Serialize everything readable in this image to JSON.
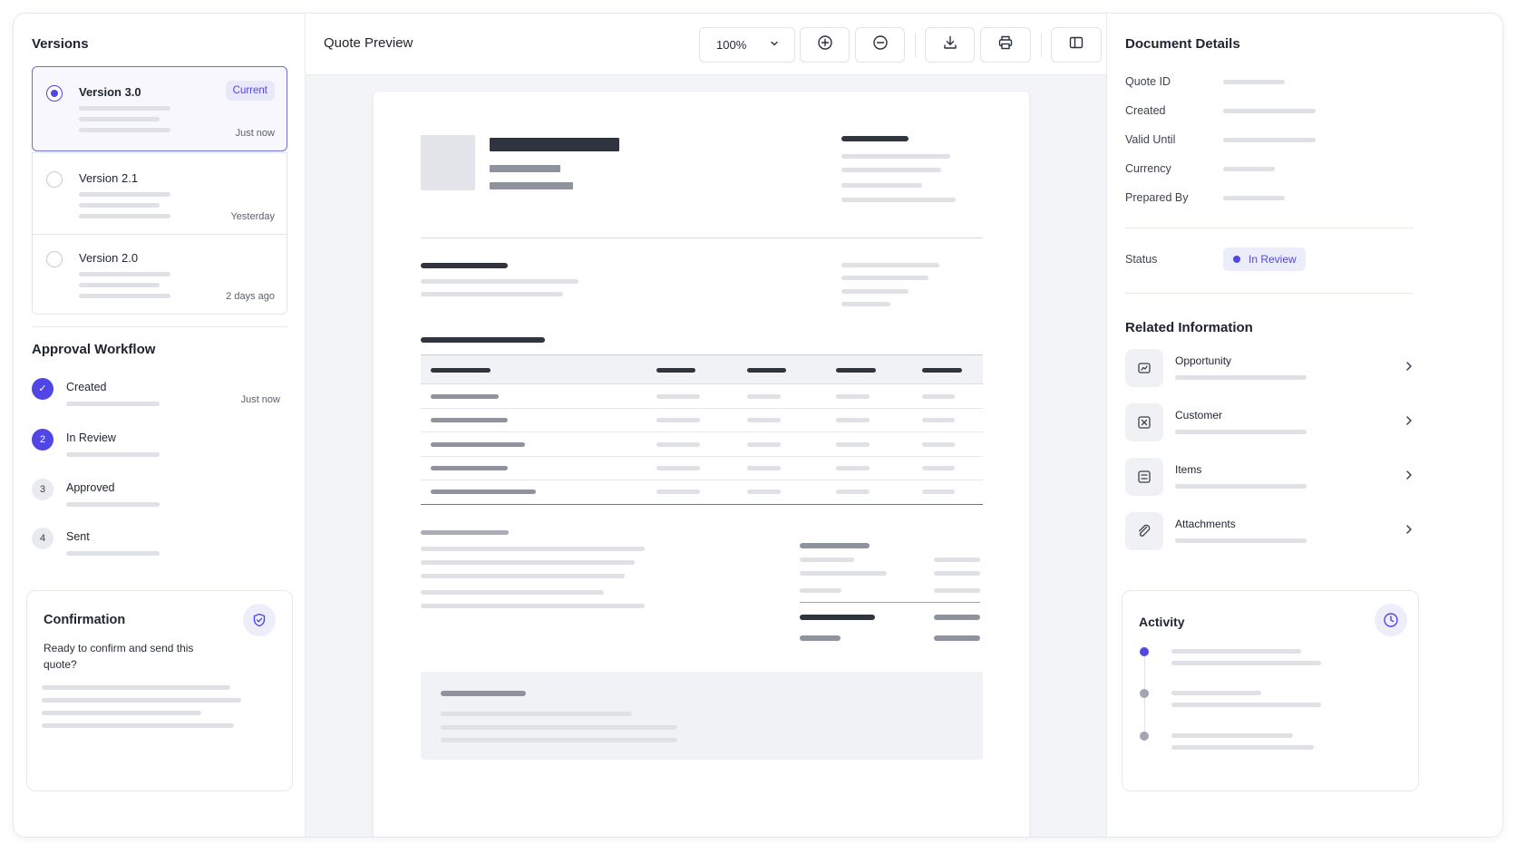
{
  "versions": {
    "title": "Versions",
    "items": [
      {
        "name": "Version 3.0",
        "badge": "Current",
        "time": "Just now",
        "selected": true
      },
      {
        "name": "Version 2.1",
        "badge": "",
        "time": "Yesterday",
        "selected": false
      },
      {
        "name": "Version 2.0",
        "badge": "",
        "time": "2 days ago",
        "selected": false
      }
    ]
  },
  "workflow": {
    "title": "Approval Workflow",
    "steps": [
      {
        "name": "Created",
        "marker": "✓",
        "state": "done",
        "time": "Just now"
      },
      {
        "name": "In Review",
        "marker": "2",
        "state": "active",
        "time": ""
      },
      {
        "name": "Approved",
        "marker": "3",
        "state": "pending",
        "time": ""
      },
      {
        "name": "Sent",
        "marker": "4",
        "state": "pending",
        "time": ""
      }
    ]
  },
  "confirmation": {
    "title": "Confirmation",
    "text": "Ready to confirm and send this quote?",
    "icon": "shield-check-icon"
  },
  "preview": {
    "title": "Quote Preview",
    "zoom": "100%",
    "icons": [
      "zoom-in-icon",
      "zoom-out-icon",
      "download-icon",
      "print-icon",
      "panel-toggle-icon"
    ]
  },
  "details": {
    "title": "Document Details",
    "fields": [
      "Quote ID",
      "Created",
      "Valid Until",
      "Currency",
      "Prepared By"
    ],
    "status_label": "Status",
    "status_value": "In Review"
  },
  "related": {
    "title": "Related Information",
    "items": [
      {
        "label": "Opportunity",
        "icon": "opportunity-icon"
      },
      {
        "label": "Customer",
        "icon": "customer-icon"
      },
      {
        "label": "Items",
        "icon": "items-icon"
      },
      {
        "label": "Attachments",
        "icon": "attachment-icon"
      }
    ]
  },
  "activity": {
    "title": "Activity",
    "icon": "clock-icon"
  },
  "colors": {
    "accent": "#4f46e5",
    "accent_light": "#e8e8fb",
    "skeleton": "#dfe1e7",
    "skeleton_dark": "#2f343f"
  }
}
